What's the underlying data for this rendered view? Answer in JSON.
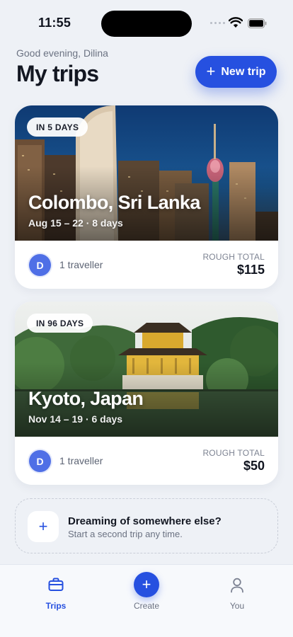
{
  "status_bar": {
    "time": "11:55"
  },
  "header": {
    "greeting": "Good evening, Dilina",
    "title": "My trips",
    "new_trip_label": "New trip"
  },
  "trips": [
    {
      "countdown": "IN 5 DAYS",
      "city": "Colombo, Sri Lanka",
      "dates": "Aug 15 – 22 · 8 days",
      "avatar_initial": "D",
      "travellers": "1 traveller",
      "total_label": "ROUGH TOTAL",
      "total_value": "$115"
    },
    {
      "countdown": "IN 96 DAYS",
      "city": "Kyoto, Japan",
      "dates": "Nov 14 – 19 · 6 days",
      "avatar_initial": "D",
      "travellers": "1 traveller",
      "total_label": "ROUGH TOTAL",
      "total_value": "$50"
    }
  ],
  "dream_card": {
    "title": "Dreaming of somewhere else?",
    "subtitle": "Start a second trip any time."
  },
  "tab_bar": {
    "tabs": [
      {
        "label": "Trips",
        "icon": "briefcase-icon",
        "active": true
      },
      {
        "label": "Create",
        "icon": "plus-icon",
        "active": false
      },
      {
        "label": "You",
        "icon": "person-icon",
        "active": false
      }
    ]
  },
  "colors": {
    "accent": "#2650e0",
    "background": "#eef1f6",
    "avatar": "#4f6fe6"
  }
}
